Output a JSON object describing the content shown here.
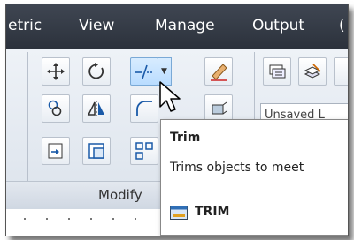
{
  "menu": {
    "items": [
      "etric",
      "View",
      "Manage",
      "Output",
      "("
    ]
  },
  "ribbon": {
    "group_label": "Modify",
    "unsaved_view_text": "Unsaved L"
  },
  "tooltip": {
    "title": "Trim",
    "description": "Trims objects to meet",
    "command_name": "TRIM"
  },
  "colors": {
    "menubar": "#2f3540",
    "ribbon": "#e6ebf2",
    "active_button": "#bcdcff"
  },
  "icons": [
    "move-icon",
    "rotate-icon",
    "trim-icon",
    "erase-icon",
    "layer-properties-icon",
    "layer-state-icon",
    "copy-icon",
    "mirror-icon",
    "fillet-icon",
    "array-icon",
    "stretch-icon",
    "scale-icon",
    "explode-icon",
    "command-line-icon",
    "cursor-arrow-icon"
  ]
}
